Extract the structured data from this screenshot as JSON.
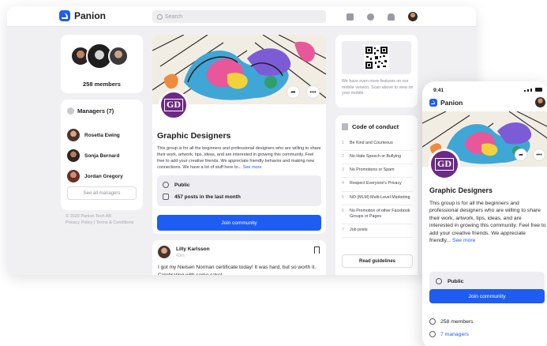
{
  "app": {
    "name": "Panion"
  },
  "search": {
    "placeholder": "Search"
  },
  "members": {
    "count_label": "258 members"
  },
  "managers": {
    "title": "Managers (7)",
    "items": [
      {
        "name": "Rosetta Ewing"
      },
      {
        "name": "Sonja Bernard"
      },
      {
        "name": "Jordan Gregory"
      }
    ],
    "see_all": "See all managers"
  },
  "footer": {
    "copyright": "© 2020 Panion Tech AB",
    "links": "Privacy Policy | Terms & Conditions"
  },
  "group": {
    "name": "Graphic Designers",
    "logo_text": "GD",
    "description": "This group is for all the beginners and professional designers who are willing to share their work, artwork, tips, ideas, and are interested in growing this community. Feel free to add your creative friends. We appreciate friendly behavior and making new connections. We have a lot of stuff here to...",
    "see_more": "See more",
    "privacy": "Public",
    "activity": "457 posts in the last month",
    "join_label": "Join community"
  },
  "post": {
    "author": "Lilly Karlsson",
    "time": "43m",
    "text": "I got my Nielsen Norman certificate today! It was hard, but so worth it. Celebrating with some cake!"
  },
  "qr": {
    "note": "We have even more features on our mobile version. Scan above to view on your mobile."
  },
  "code_of_conduct": {
    "title": "Code of conduct",
    "rules": [
      "Be Kind and Courteous",
      "No Hate Speech or Bullying",
      "No Promotions or Spam",
      "Respect Everyone's Privacy",
      "NO (MLM) Multi-Level Marketing",
      "No Promotion of other Facebook Groups or Pages",
      "Job posts"
    ],
    "button": "Read guidelines"
  },
  "mobile": {
    "time": "9:41",
    "description": "This group is for all the beginners and professional designers who are willing to share their work, artwork, tips, ideas, and are interested in growing this community. Feel free to add your creative friends. We  appreciate friendly...",
    "see_more": "See more",
    "members": "258 members",
    "managers": "7 managers"
  },
  "colors": {
    "brand": "#1f5cf2",
    "group_logo": "#6b2a86"
  },
  "icons": [
    "search-icon",
    "calendar-icon",
    "chat-icon",
    "bell-icon",
    "share-icon",
    "more-icon",
    "globe-icon",
    "posts-icon",
    "bookmark-icon",
    "qr-code-icon",
    "rules-icon",
    "members-icon"
  ]
}
